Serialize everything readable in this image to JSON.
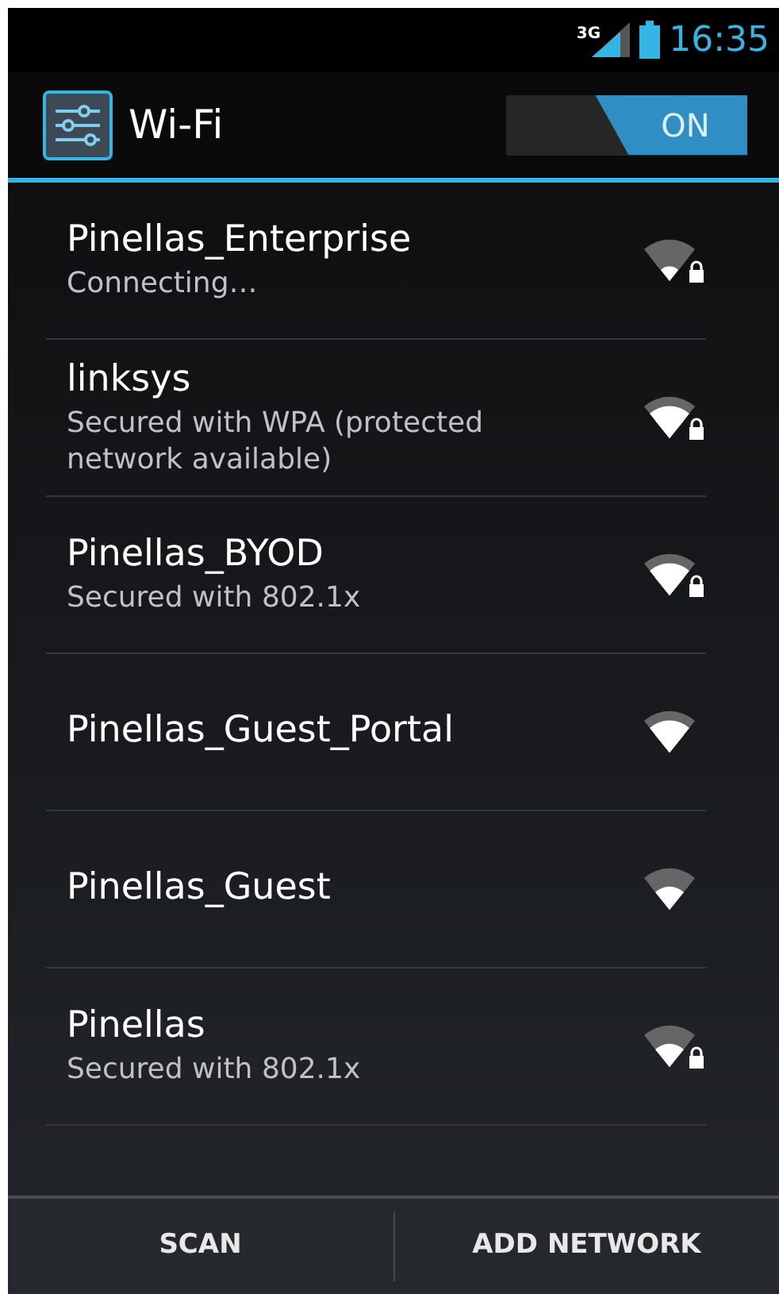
{
  "status_bar": {
    "network": "3G",
    "time": "16:35"
  },
  "action_bar": {
    "title": "Wi-Fi",
    "toggle": {
      "label": "ON",
      "on": true
    }
  },
  "networks": [
    {
      "name": "Pinellas_Enterprise",
      "status": "Connecting…",
      "secured": true,
      "kind": "weak"
    },
    {
      "name": "linksys",
      "status": "Secured with WPA (protected network available)",
      "secured": true,
      "kind": "good"
    },
    {
      "name": "Pinellas_BYOD",
      "status": "Secured with 802.1x",
      "secured": true,
      "kind": "good"
    },
    {
      "name": "Pinellas_Guest_Portal",
      "secured": false,
      "kind": "good"
    },
    {
      "name": "Pinellas_Guest",
      "secured": false,
      "kind": "fair"
    },
    {
      "name": "Pinellas",
      "status": "Secured with 802.1x",
      "secured": true,
      "kind": "fair"
    }
  ],
  "buttons": [
    "SCAN",
    "ADD NETWORK"
  ]
}
